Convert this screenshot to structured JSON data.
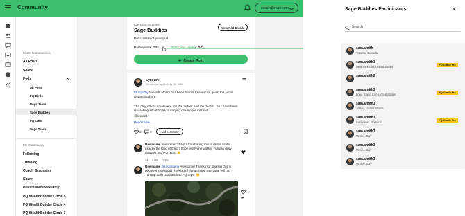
{
  "topbar": {
    "title": "Community",
    "account_email": "coach@mail.com"
  },
  "sidebar": {
    "top_links": [
      "All Posts",
      "Share"
    ],
    "pods_label": "Pods",
    "section_client": "Client Communities",
    "pods": [
      "All Pods",
      "PQ Birds",
      "Reps Team",
      "Sage Buddies",
      "PQ Cats",
      "Sage Team"
    ],
    "section_my": "My Community",
    "my_links": [
      "Following",
      "Trending",
      "Coach Graduates",
      "Share",
      "Private Members Only",
      "PQ WealthBuilder Circle 5",
      "PQ WealthBuilder Circle 4",
      "PQ WealthBuilder Circle 3"
    ]
  },
  "pod": {
    "crumb": "Client Communities",
    "name": "Sage Buddies",
    "view_details": "View Pod Details",
    "description": "Description of your pod.",
    "participants_label": "Participants:",
    "participants_count": "132",
    "posts_label": "Posts and replies:",
    "posts_count": "242",
    "create_post": "Create Post"
  },
  "post": {
    "author": "Lynoure",
    "meta": "15 minutes ago in May 18, 2024",
    "hashtag": "#Empathy",
    "body1": " towards others has been harder to exercise given the social distancing here.",
    "body2": "The only others I met were my life partner and my dentist. So I have been visualising situation as of varying challenges instead.",
    "mention": "@shirazd",
    "read_more": "Read more...",
    "likes": "2",
    "comments": "3",
    "add_comment": "Add comment"
  },
  "comments": [
    {
      "name": "Username",
      "mention": "",
      "text": " Awesome! Thanks for sharing this in detail as it's exactly the kind of thing I hope everyone will try. Turning daily routines into PQ reps. 👏",
      "time": "3d",
      "likes": "1 like",
      "reply": "Reply"
    },
    {
      "name": "Username",
      "mention": "@Username",
      "text": " Awesome! Thanks for sharing this in detail as it's exactly the kind of thing I hope everyone will try. Turning daily routines into PQ reps. 👏"
    }
  ],
  "panel": {
    "title": "Sage Buddies Participants",
    "search_placeholder": "Search",
    "badge_label": "PQ Coach Pro",
    "participants": [
      {
        "name": "sam.smith",
        "location": "Toronto, Canada",
        "badge": false
      },
      {
        "name": "sam.smith1",
        "location": "New York City, United States",
        "badge": true
      },
      {
        "name": "sam.smith2",
        "location": "",
        "badge": false
      },
      {
        "name": "sam.smith3",
        "location": "Long Island City, United States",
        "badge": true
      },
      {
        "name": "sam.smith3",
        "location": "Jersey, United States",
        "badge": false
      },
      {
        "name": "sam.smith3",
        "location": "Bucharest, Romania",
        "badge": true
      },
      {
        "name": "sam.smith3",
        "location": "Venice, Italy",
        "badge": false
      },
      {
        "name": "sam.smith3",
        "location": "Venice, Italy",
        "badge": false
      },
      {
        "name": "sam.smith3",
        "location": "Venice, Italy",
        "badge": false
      }
    ]
  },
  "colors": {
    "brand_green": "#3cbf6d",
    "badge_yellow": "#f5c518",
    "link_blue": "#2a55c9"
  }
}
